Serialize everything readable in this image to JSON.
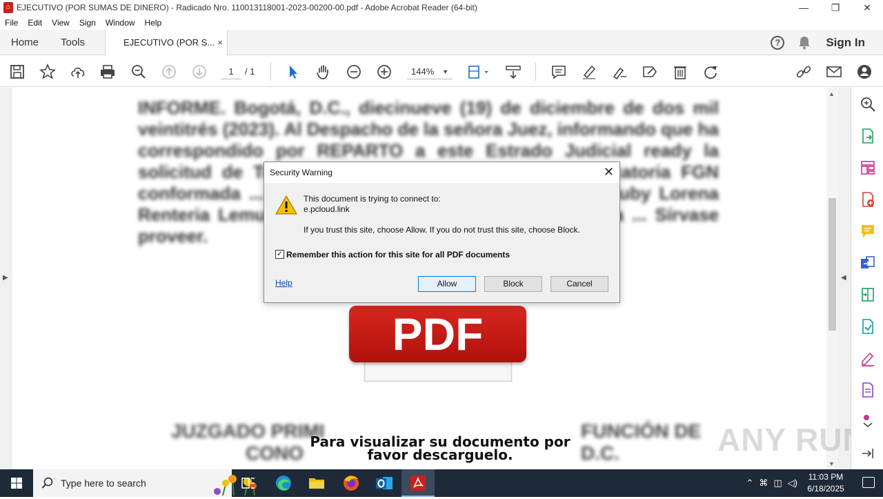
{
  "window": {
    "title": "EJECUTIVO (POR SUMAS DE DINERO) - Radicado Nro. 110013118001-2023-00200-00.pdf - Adobe Acrobat Reader (64-bit)",
    "controls": [
      "—",
      "❐",
      "✕"
    ]
  },
  "menu": [
    "File",
    "Edit",
    "View",
    "Sign",
    "Window",
    "Help"
  ],
  "tabs": {
    "home": "Home",
    "tools": "Tools",
    "doc": "EJECUTIVO (POR S...",
    "close": "×",
    "signin": "Sign In",
    "help": "?"
  },
  "toolbar": {
    "page_current": "1",
    "page_total": "/ 1",
    "zoom": "144%",
    "zoom_caret": "▼"
  },
  "document": {
    "blurred_paragraph": "INFORME. Bogotá, D.C., diecinueve (19) de diciembre de dos mil veintitrés (2023). Al Despacho de la señora Juez, informando que ha correspondido por REPARTO a este Estrado Judicial ready la solicitud de Tutela contra la Unión Temporal Convocatoria FGN conformada ... y la Fiscalía General de la Nación ... Ruby Lorena Renteria Lemus, ... a la igualdad, debido proceso, a la ... Sírvase proveer.",
    "blurred_left_1": "JUZGADO PRIMI",
    "blurred_left_2": "CONO",
    "blurred_right_1": "FUNCIÓN DE",
    "blurred_right_2": "D.C.",
    "pdf_logo": "PDF",
    "download_line1": "Para visualizar su documento por",
    "download_line2": "favor descarguelo.",
    "watermark": "ANY RUN"
  },
  "dialog": {
    "title": "Security Warning",
    "close": "✕",
    "message_line1": "This document is trying to connect to:",
    "host": "e.pcloud.link",
    "message_line3": "If you trust this site, choose Allow. If you do not trust this site, choose Block.",
    "checkbox_checked": true,
    "checkbox_mark": "✓",
    "checkbox_label": "Remember this action for this site for all PDF documents",
    "help": "Help",
    "allow": "Allow",
    "block": "Block",
    "cancel": "Cancel"
  },
  "taskbar": {
    "search_placeholder": "Type here to search",
    "time": "11:03 PM",
    "date": "6/18/2025"
  },
  "colors": {
    "accent": "#0078d7",
    "pdf_red": "#c8211b",
    "taskbar": "#1f2a38"
  }
}
